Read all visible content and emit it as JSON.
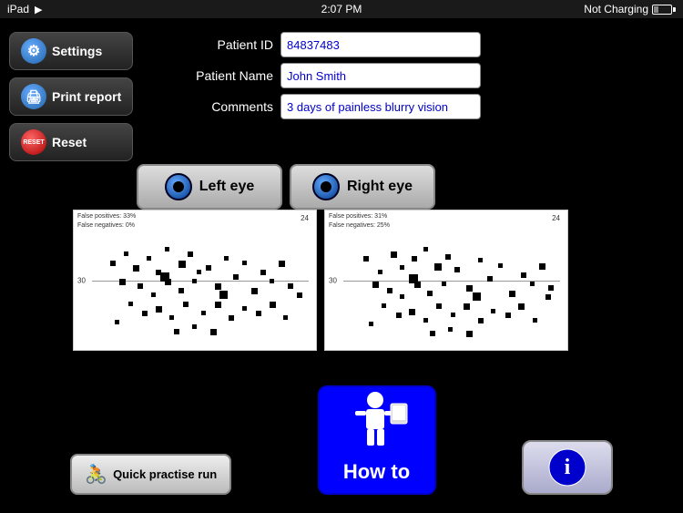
{
  "statusBar": {
    "left": "iPad",
    "time": "2:07 PM",
    "charging": "Not Charging"
  },
  "sidebar": {
    "settings_label": "Settings",
    "print_label": "Print report",
    "reset_label": "Reset",
    "reset_icon_text": "RESET"
  },
  "patientForm": {
    "patient_id_label": "Patient ID",
    "patient_name_label": "Patient Name",
    "comments_label": "Comments",
    "patient_id_value": "84837483",
    "patient_name_value": "John Smith",
    "comments_value": "3 days of painless blurry vision"
  },
  "eyeButtons": {
    "left_label": "Left eye",
    "right_label": "Right eye"
  },
  "charts": {
    "left": {
      "stat1": "False positives: 33%",
      "stat2": "False negatives: 0%",
      "number_top": "24",
      "number_side": "30"
    },
    "right": {
      "stat1": "False positives: 31%",
      "stat2": "False negatives: 25%",
      "number_top": "24",
      "number_side": "30"
    }
  },
  "bottomButtons": {
    "quick_label": "Quick practise run",
    "how_to_label": "How to",
    "info_symbol": "ℹ"
  }
}
